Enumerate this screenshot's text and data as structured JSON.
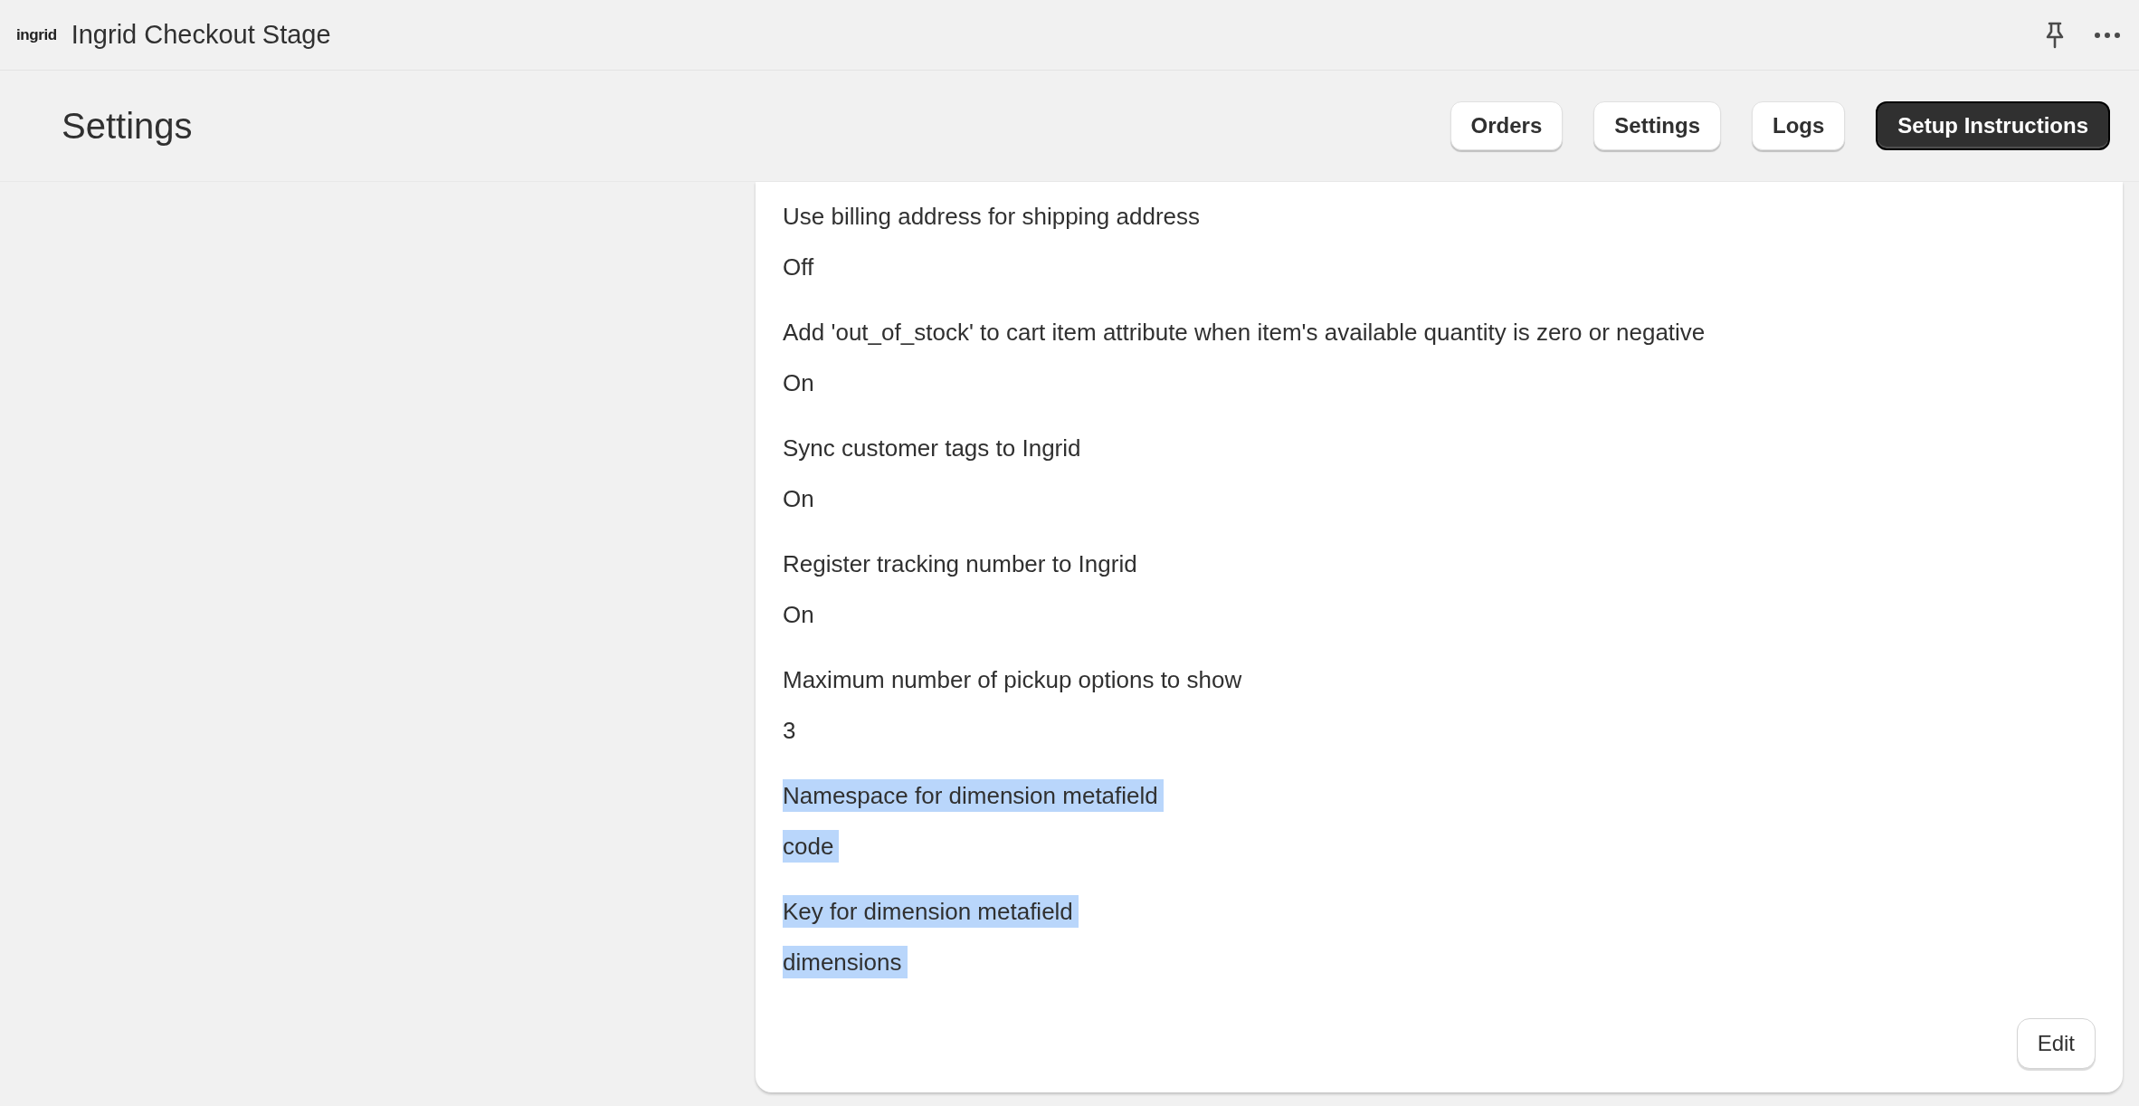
{
  "app_bar": {
    "logo": "ingrid",
    "title": "Ingrid Checkout Stage"
  },
  "page": {
    "title": "Settings",
    "actions": [
      {
        "label": "Orders",
        "primary": false
      },
      {
        "label": "Settings",
        "primary": false
      },
      {
        "label": "Logs",
        "primary": false
      },
      {
        "label": "Setup Instructions",
        "primary": true
      }
    ]
  },
  "settings": [
    {
      "label": "Use billing address for shipping address",
      "value": "Off",
      "highlighted": false
    },
    {
      "label": "Add 'out_of_stock' to cart item attribute when item's available quantity is zero or negative",
      "value": "On",
      "highlighted": false
    },
    {
      "label": "Sync customer tags to Ingrid",
      "value": "On",
      "highlighted": false
    },
    {
      "label": "Register tracking number to Ingrid",
      "value": "On",
      "highlighted": false
    },
    {
      "label": "Maximum number of pickup options to show",
      "value": "3",
      "highlighted": false
    },
    {
      "label": "Namespace for dimension metafield",
      "value": "code",
      "highlighted": true
    },
    {
      "label": "Key for dimension metafield",
      "value": "dimensions",
      "highlighted": true
    }
  ],
  "edit_button": "Edit"
}
